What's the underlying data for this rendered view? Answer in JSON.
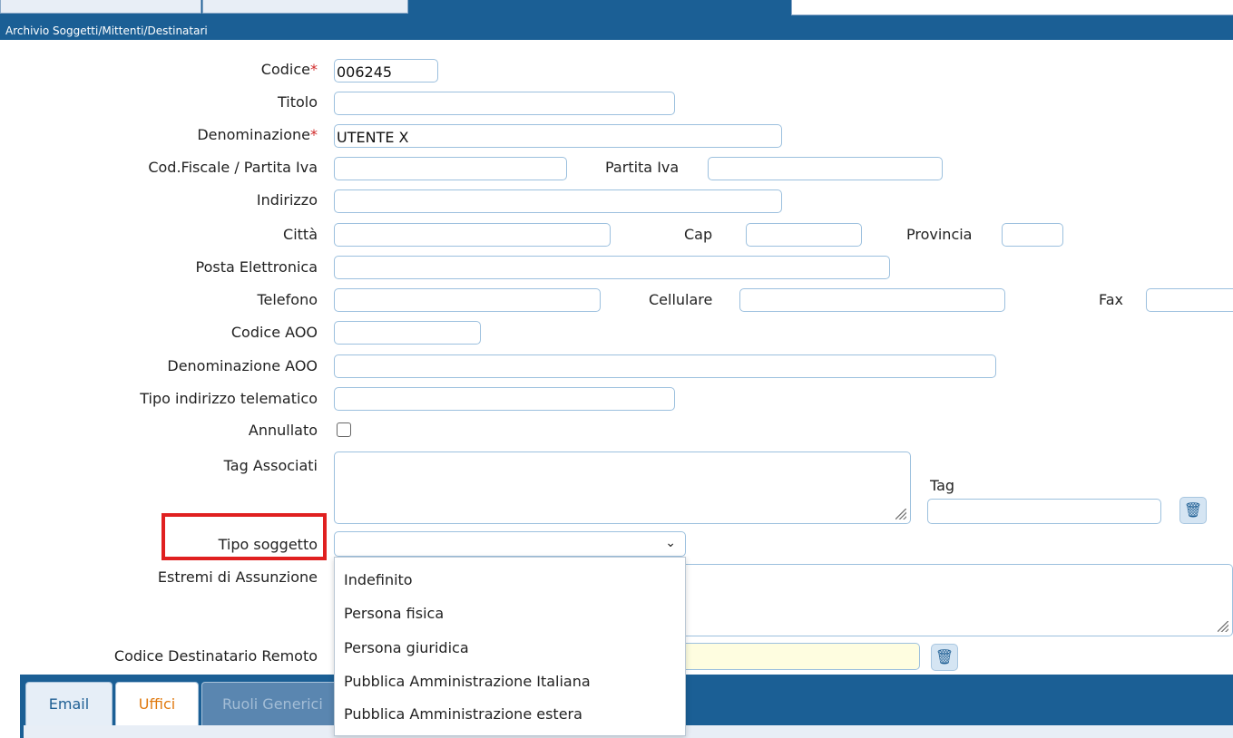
{
  "window": {
    "title": "Archivio Soggetti/Mittenti/Destinatari"
  },
  "form": {
    "codice": {
      "label": "Codice",
      "value": "006245"
    },
    "titolo": {
      "label": "Titolo",
      "value": ""
    },
    "denominazione": {
      "label": "Denominazione",
      "value": "UTENTE X"
    },
    "cod_fiscale": {
      "label": "Cod.Fiscale / Partita Iva",
      "value": ""
    },
    "partita_iva": {
      "label": "Partita Iva",
      "value": ""
    },
    "indirizzo": {
      "label": "Indirizzo",
      "value": ""
    },
    "citta": {
      "label": "Città",
      "value": ""
    },
    "cap": {
      "label": "Cap",
      "value": ""
    },
    "provincia": {
      "label": "Provincia",
      "value": ""
    },
    "posta_elettronica": {
      "label": "Posta Elettronica",
      "value": ""
    },
    "telefono": {
      "label": "Telefono",
      "value": ""
    },
    "cellulare": {
      "label": "Cellulare",
      "value": ""
    },
    "fax": {
      "label": "Fax",
      "value": ""
    },
    "codice_aoo": {
      "label": "Codice AOO",
      "value": ""
    },
    "denominazione_aoo": {
      "label": "Denominazione AOO",
      "value": ""
    },
    "tipo_indirizzo": {
      "label": "Tipo indirizzo telematico",
      "value": ""
    },
    "annullato": {
      "label": "Annullato",
      "checked": false
    },
    "tag_associati": {
      "label": "Tag Associati"
    },
    "tag": {
      "label": "Tag",
      "value": ""
    },
    "tipo_soggetto": {
      "label": "Tipo soggetto",
      "value": "",
      "options": [
        "Indefinito",
        "Persona fisica",
        "Persona giuridica",
        "Pubblica Amministrazione Italiana",
        "Pubblica Amministrazione estera"
      ]
    },
    "estremi": {
      "label": "Estremi di Assunzione"
    },
    "codice_remoto": {
      "label": "Codice Destinatario Remoto"
    },
    "required_marker": "*"
  },
  "tabs": [
    {
      "label": "Email"
    },
    {
      "label": "Uffici"
    },
    {
      "label": "Ruoli Generici"
    }
  ],
  "icons": {
    "delete": "trash-icon",
    "dropdown": "chevron-down-icon",
    "resize": "resize-grip-icon"
  },
  "colors": {
    "header": "#1b5f95",
    "required": "#d12a2a",
    "highlight": "#e02020",
    "active_tab": "#e07a10"
  }
}
